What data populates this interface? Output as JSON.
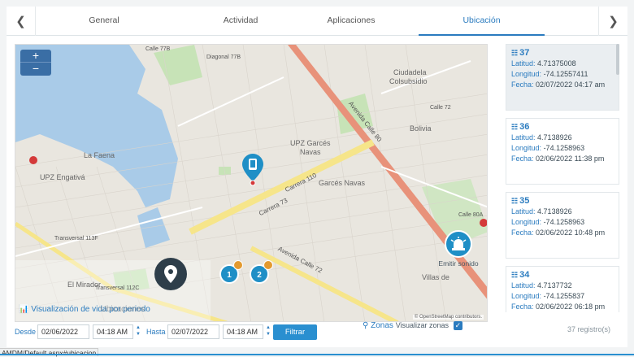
{
  "tabs": [
    "General",
    "Actividad",
    "Aplicaciones",
    "Ubicación"
  ],
  "active_tab": "Ubicación",
  "map": {
    "zoom_in": "+",
    "zoom_out": "−",
    "labels": {
      "ciudadela": "Ciudadela",
      "colsubsidio": "Colsubsidio",
      "la_faena": "La Faena",
      "upz_engativa": "UPZ Engativá",
      "upz_garces": "UPZ Garcés",
      "navas": "Navas",
      "garces_navas": "Garcés Navas",
      "bolivia": "Bolivia",
      "el_mirador": "El Mirador",
      "villas": "Villas de",
      "av_calle80": "Avenida Calle 80",
      "av_calle72": "Avenida Calle 72",
      "carrera110": "Carrera 110",
      "carrera_73": "Carrera 73",
      "diagonal77b": "Diagonal 77B",
      "transversal113f": "Transversal 113F",
      "transversal112c": "Transversal 112C",
      "calle80a": "Calle 80A",
      "calle72": "Calle 72",
      "calle77b": "Calle 77B"
    },
    "cluster_1": "1",
    "cluster_2": "2",
    "emit_label": "Emitir sonido",
    "viz_link": "Visualización de vida por periodo",
    "viz_ghost": "Ubicaciones",
    "attribution": "© OpenStreetMap contributors."
  },
  "filters": {
    "desde_label": "Desde",
    "desde_date": "02/06/2022",
    "desde_time": "04:18 AM",
    "hasta_label": "Hasta",
    "hasta_date": "02/07/2022",
    "hasta_time": "04:18 AM",
    "filter_button": "Filtrar",
    "zonas_label": "Zonas",
    "zonas_sub": "Visualizar zonas",
    "zonas_checked": "✓"
  },
  "records": [
    {
      "num": "37",
      "lat_label": "Latitud:",
      "lat": "4.71375008",
      "lon_label": "Longitud:",
      "lon": "-74.12557411",
      "date_label": "Fecha:",
      "date": "02/07/2022 04:17 am"
    },
    {
      "num": "36",
      "lat_label": "Latitud:",
      "lat": "4.7138926",
      "lon_label": "Longitud:",
      "lon": "-74.1258963",
      "date_label": "Fecha:",
      "date": "02/06/2022 11:38 pm"
    },
    {
      "num": "35",
      "lat_label": "Latitud:",
      "lat": "4.7138926",
      "lon_label": "Longitud:",
      "lon": "-74.1258963",
      "date_label": "Fecha:",
      "date": "02/06/2022 10:48 pm"
    },
    {
      "num": "34",
      "lat_label": "Latitud:",
      "lat": "4.7137732",
      "lon_label": "Longitud:",
      "lon": "-74.1255837",
      "date_label": "Fecha:",
      "date": "02/06/2022 06:18 pm"
    }
  ],
  "record_count": "37 registro(s)",
  "status_url": "AMDM/Default.aspx#ubicacion",
  "colors": {
    "accent": "#2a7bbf",
    "marker": "#1f8fc6",
    "avenue": "#e8927a",
    "water": "#a9cbe8"
  }
}
